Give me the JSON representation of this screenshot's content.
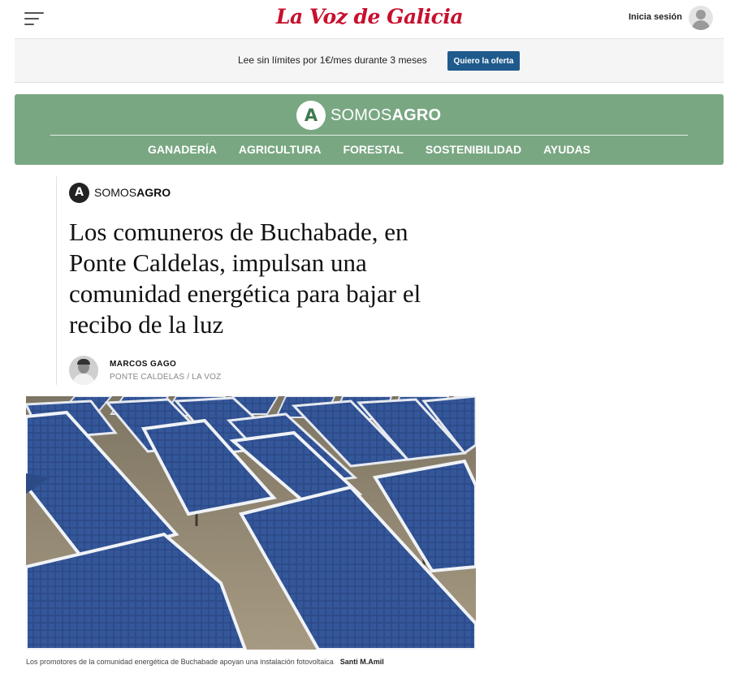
{
  "header": {
    "logo": "La Voz de Galicia",
    "login_label": "Inicia sesión"
  },
  "promo": {
    "text": "Lee sin límites por 1€/mes durante 3 meses",
    "button_label": "Quiero la oferta"
  },
  "section": {
    "logo_letter": "A",
    "logo_light": "SOMOS",
    "logo_bold": "AGRO",
    "nav": [
      "GANADERÍA",
      "AGRICULTURA",
      "FORESTAL",
      "SOSTENIBILIDAD",
      "AYUDAS"
    ],
    "color": "#79a782"
  },
  "article": {
    "kicker_letter": "A",
    "kicker_light": "SOMOS",
    "kicker_bold": "AGRO",
    "headline": "Los comuneros de Buchabade, en Ponte Caldelas, impulsan una comunidad energética para bajar el recibo de la luz",
    "author_name": "MARCOS GAGO",
    "author_location": "PONTE CALDELAS / LA VOZ",
    "image": {
      "caption": "Los promotores de la comunidad energética de Buchabade apoyan una instalación fotovoltaica",
      "credit": "Santi M.Amil"
    }
  },
  "colors": {
    "brand_red": "#c8102e",
    "offer_button": "#1f5a8c"
  }
}
